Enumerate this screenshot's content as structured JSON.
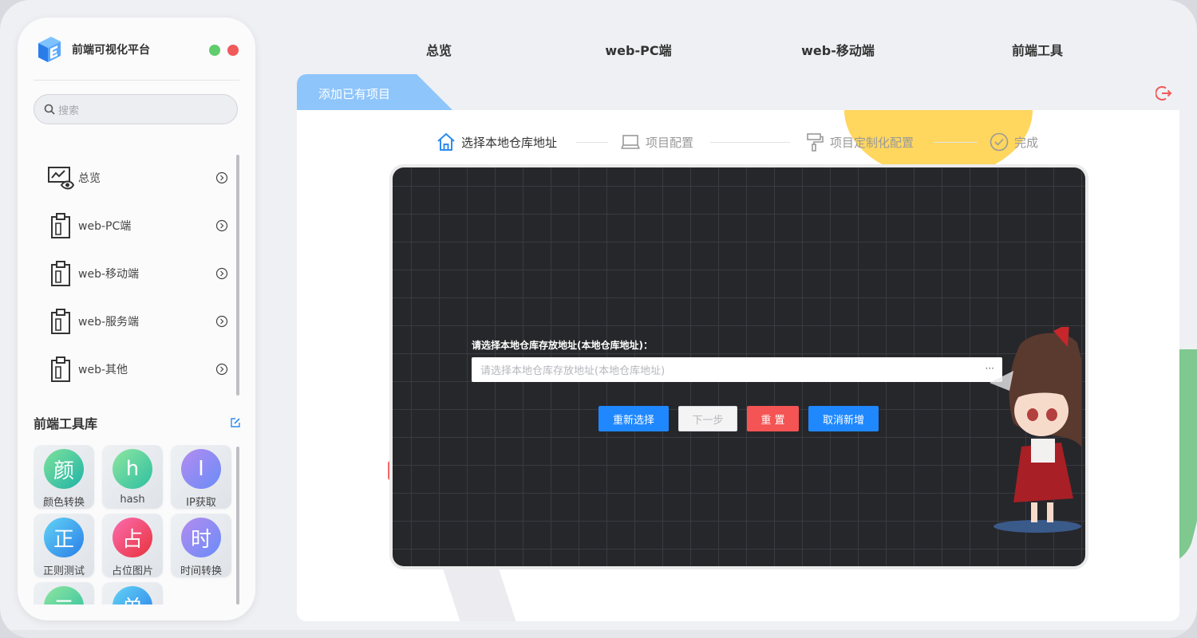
{
  "sidebar": {
    "brand_title": "前端可视化平台",
    "search_placeholder": "搜索",
    "nav_items": [
      {
        "label": "总览",
        "icon": "dashboard-eye-icon"
      },
      {
        "label": "web-PC端",
        "icon": "clipboard-icon"
      },
      {
        "label": "web-移动端",
        "icon": "clipboard-icon"
      },
      {
        "label": "web-服务端",
        "icon": "clipboard-icon"
      },
      {
        "label": "web-其他",
        "icon": "clipboard-icon"
      }
    ],
    "tools_title": "前端工具库",
    "tools": [
      {
        "char": "颜",
        "label": "颜色转换",
        "color_from": "#7ee29a",
        "color_to": "#1fb3a8"
      },
      {
        "char": "h",
        "label": "hash",
        "color_from": "#8fe6a0",
        "color_to": "#2dbfa1"
      },
      {
        "char": "I",
        "label": "IP获取",
        "color_from": "#b38cf0",
        "color_to": "#6a8cf7"
      },
      {
        "char": "正",
        "label": "正则测试",
        "color_from": "#62d3f5",
        "color_to": "#2a7ee8"
      },
      {
        "char": "占",
        "label": "占位图片",
        "color_from": "#fb6db0",
        "color_to": "#e8323b"
      },
      {
        "char": "时",
        "label": "时间转换",
        "color_from": "#b38cf0",
        "color_to": "#6a8cf7"
      },
      {
        "char": "二",
        "label": "",
        "color_from": "#8fe6a0",
        "color_to": "#2dbfa1"
      },
      {
        "char": "单",
        "label": "",
        "color_from": "#62d3f5",
        "color_to": "#2a7ee8"
      }
    ]
  },
  "topnav": [
    "总览",
    "web-PC端",
    "web-移动端",
    "前端工具"
  ],
  "panel": {
    "tab_label": "添加已有项目",
    "steps": [
      {
        "label": "选择本地仓库地址",
        "state": "active",
        "icon": "home-icon"
      },
      {
        "label": "项目配置",
        "state": "pending",
        "icon": "laptop-icon"
      },
      {
        "label": "项目定制化配置",
        "state": "pending",
        "icon": "paint-roller-icon"
      },
      {
        "label": "完成",
        "state": "pending",
        "icon": "check-circle-icon"
      }
    ],
    "form": {
      "label": "请选择本地仓库存放地址(本地仓库地址)：",
      "placeholder": "请选择本地仓库存放地址(本地仓库地址)",
      "browse": "···"
    },
    "buttons": {
      "reselect": "重新选择",
      "next": "下一步",
      "reset": "重 置",
      "cancel": "取消新增"
    }
  },
  "colors": {
    "primary": "#1f88ff",
    "danger": "#f45454",
    "tab": "#8ec5fb",
    "step_active": "#333333",
    "step_pending": "#999999"
  }
}
